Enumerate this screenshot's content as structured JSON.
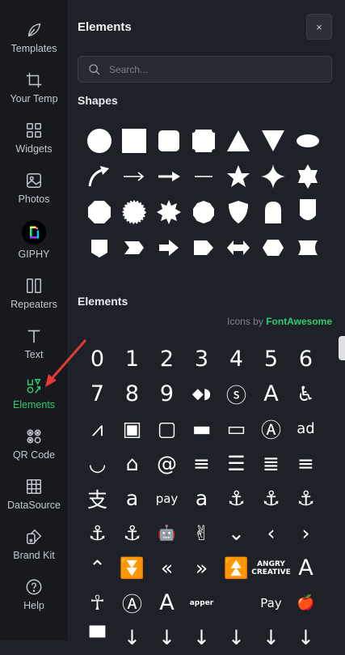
{
  "rail": {
    "items": [
      {
        "label": "Templates",
        "icon": "leaf-icon"
      },
      {
        "label": "Your Temp",
        "icon": "crop-icon"
      },
      {
        "label": "Widgets",
        "icon": "widgets-grid-icon"
      },
      {
        "label": "Photos",
        "icon": "photo-icon"
      },
      {
        "label": "GIPHY",
        "icon": "giphy-icon"
      },
      {
        "label": "Repeaters",
        "icon": "columns-icon"
      },
      {
        "label": "Text",
        "icon": "text-t-icon"
      },
      {
        "label": "Elements",
        "icon": "elements-icon",
        "active": true
      },
      {
        "label": "QR Code",
        "icon": "qr-code-icon"
      },
      {
        "label": "DataSource",
        "icon": "table-icon"
      },
      {
        "label": "Brand Kit",
        "icon": "brand-kit-icon"
      },
      {
        "label": "Help",
        "icon": "help-icon"
      }
    ]
  },
  "panel": {
    "title": "Elements",
    "close_label": "×",
    "search_placeholder": "Search...",
    "shapes_title": "Shapes",
    "elements_title": "Elements",
    "icons_by_prefix": "Icons by",
    "icons_by_brand": "FontAwesome"
  },
  "colors": {
    "accent": "#2ecc71",
    "background": "#1e2128",
    "rail": "#17191e",
    "annotation_arrow": "#e53935"
  },
  "shapes": [
    "circle",
    "square",
    "rounded-square",
    "scalloped-square",
    "triangle-up",
    "triangle-down",
    "ellipse",
    "curved-arrow",
    "thin-arrow",
    "bold-arrow",
    "line",
    "star",
    "four-point-star",
    "six-point-star",
    "octagon",
    "starburst-circle",
    "starburst",
    "decagon",
    "shield",
    "arch",
    "tag-down",
    "pentagon-down",
    "chevron",
    "arrow-block",
    "tag-right",
    "double-arrow",
    "hexagon",
    "bowtie"
  ],
  "icons": [
    {
      "name": "digit-0",
      "text": "0"
    },
    {
      "name": "digit-1",
      "text": "1"
    },
    {
      "name": "digit-2",
      "text": "2"
    },
    {
      "name": "digit-3",
      "text": "3"
    },
    {
      "name": "digit-4",
      "text": "4"
    },
    {
      "name": "digit-5",
      "text": "5"
    },
    {
      "name": "digit-6",
      "text": "6"
    },
    {
      "name": "digit-7",
      "text": "7"
    },
    {
      "name": "digit-8",
      "text": "8"
    },
    {
      "name": "digit-9",
      "text": "9"
    },
    {
      "name": "bowtie-glyph",
      "text": "◆◗"
    },
    {
      "name": "500px-logo",
      "text": "ⓢ"
    },
    {
      "name": "letter-a",
      "text": "A"
    },
    {
      "name": "accessible",
      "text": "♿"
    },
    {
      "name": "accusoft",
      "text": "⩘"
    },
    {
      "name": "address-book",
      "text": "▣"
    },
    {
      "name": "address-book-outline",
      "text": "▢"
    },
    {
      "name": "address-card",
      "text": "▬"
    },
    {
      "name": "address-card-outline",
      "text": "▭"
    },
    {
      "name": "adn",
      "text": "Ⓐ"
    },
    {
      "name": "ad",
      "text": "ad"
    },
    {
      "name": "adversal",
      "text": "◡"
    },
    {
      "name": "airbnb",
      "text": "⌂"
    },
    {
      "name": "algolia",
      "text": "@"
    },
    {
      "name": "align-center",
      "text": "≡"
    },
    {
      "name": "align-justify",
      "text": "☰"
    },
    {
      "name": "align-left",
      "text": "≣"
    },
    {
      "name": "align-right",
      "text": "≡"
    },
    {
      "name": "alipay",
      "text": "支"
    },
    {
      "name": "amazon",
      "text": "a"
    },
    {
      "name": "amazon-pay",
      "text": "pay"
    },
    {
      "name": "amilia",
      "text": "a"
    },
    {
      "name": "anchor",
      "text": "⚓"
    },
    {
      "name": "anchor-circle-check",
      "text": "⚓"
    },
    {
      "name": "anchor-circle-exclamation",
      "text": "⚓"
    },
    {
      "name": "anchor-circle-xmark",
      "text": "⚓"
    },
    {
      "name": "anchor-lock",
      "text": "⚓"
    },
    {
      "name": "android",
      "text": "🤖"
    },
    {
      "name": "angellist",
      "text": "✌"
    },
    {
      "name": "angle-down",
      "text": "⌄"
    },
    {
      "name": "angle-left",
      "text": "‹"
    },
    {
      "name": "angle-right",
      "text": "›"
    },
    {
      "name": "angle-up",
      "text": "⌃"
    },
    {
      "name": "angles-down",
      "text": "⏬"
    },
    {
      "name": "angles-left",
      "text": "«"
    },
    {
      "name": "angles-right",
      "text": "»"
    },
    {
      "name": "angles-up",
      "text": "⏫"
    },
    {
      "name": "angry-creative",
      "text": "ANGRY CREATIVE"
    },
    {
      "name": "angular",
      "text": "A"
    },
    {
      "name": "ankh",
      "text": "☥"
    },
    {
      "name": "app-store",
      "text": "Ⓐ"
    },
    {
      "name": "app-store-ios",
      "text": "A"
    },
    {
      "name": "apper",
      "text": "apper"
    },
    {
      "name": "apple",
      "text": ""
    },
    {
      "name": "apple-pay",
      "text": " Pay"
    },
    {
      "name": "apple-whole",
      "text": "🍎"
    },
    {
      "name": "archway",
      "text": "▀"
    },
    {
      "name": "arrow-down",
      "text": "↓"
    },
    {
      "name": "arrow-down-1-9",
      "text": "↓"
    },
    {
      "name": "arrow-down-9-1",
      "text": "↓"
    },
    {
      "name": "arrow-down-a-z",
      "text": "↓"
    },
    {
      "name": "arrow-down-long",
      "text": "↓"
    },
    {
      "name": "arrow-down-short-wide",
      "text": "↓"
    }
  ]
}
